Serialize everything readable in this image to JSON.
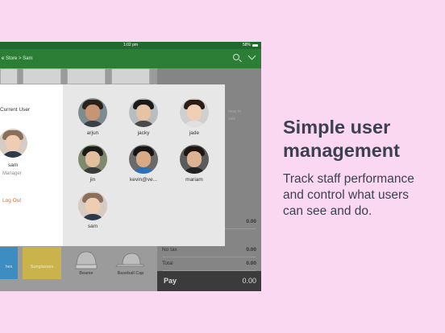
{
  "status_bar": {
    "time": "1:02 pm",
    "battery": "58%"
  },
  "app_bar": {
    "breadcrumb": "e Store > Sam",
    "search_icon": "search-icon",
    "menu_icon": "chevron-down-icon"
  },
  "colors": {
    "app_green": "#2c7d36",
    "status_green": "#1f6a2c",
    "logout_orange": "#e06a2b",
    "background_pink": "#fbd8f1",
    "pay_bar": "#3b3b3b"
  },
  "background_pos": {
    "hint": "ness to\nsale",
    "rows": [
      {
        "label": "",
        "value": "0.00"
      },
      {
        "label": "No tax",
        "value": "0.00"
      },
      {
        "label": "Total",
        "value": "0.00"
      }
    ],
    "pay_label": "Pay",
    "pay_amount": "0.00",
    "tiles": [
      {
        "label": "hes"
      },
      {
        "label": "Sunglasses"
      },
      {
        "label": "Beanie"
      },
      {
        "label": "Baseball Cap"
      }
    ]
  },
  "user_modal": {
    "current_user_label": "Current User",
    "current_user": {
      "name": "sam",
      "role": "Manager"
    },
    "logout_label": "Log Out",
    "users": [
      {
        "name": "arjun"
      },
      {
        "name": "jacky"
      },
      {
        "name": "jade"
      },
      {
        "name": "jin"
      },
      {
        "name": "kevin@ve..."
      },
      {
        "name": "mariam"
      },
      {
        "name": "sam"
      }
    ]
  },
  "promo": {
    "headline_line1": "Simple user",
    "headline_line2": "management",
    "sub_line1": "Track staff performance",
    "sub_line2": "and control what users",
    "sub_line3": "can see and do."
  }
}
